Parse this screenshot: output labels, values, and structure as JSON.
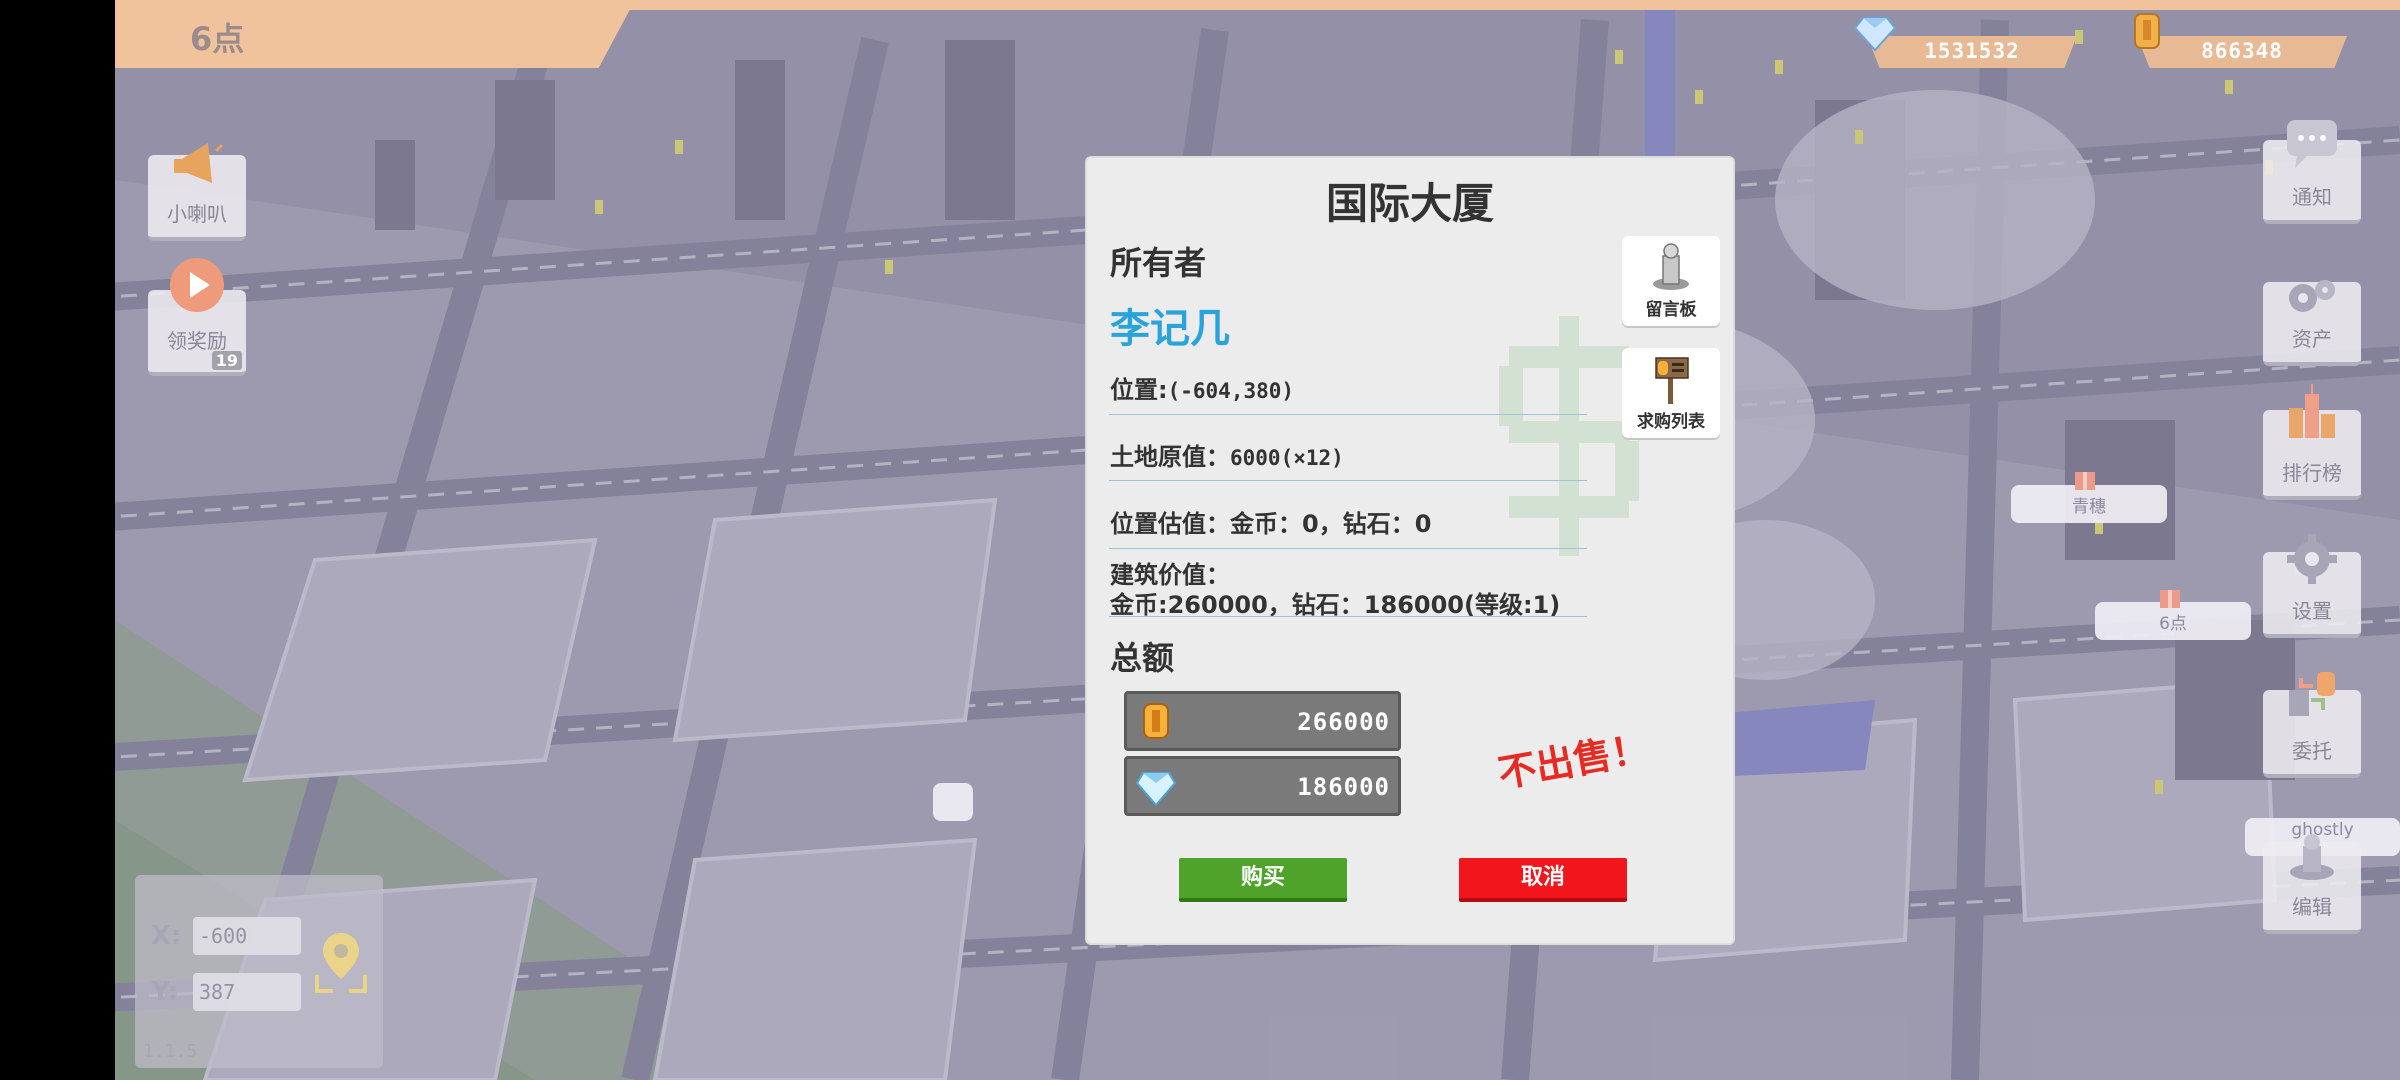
{
  "topbar": {
    "time_label": "6点"
  },
  "currency": {
    "diamonds": "1531532",
    "coins": "866348"
  },
  "left_buttons": {
    "speaker": "小喇叭",
    "reward": "领奖励",
    "reward_badge": "19"
  },
  "coords": {
    "x_label": "X:",
    "x_value": "-600",
    "y_label": "Y:",
    "y_value": "387",
    "version": "1.1.5"
  },
  "right_buttons": {
    "notify": "通知",
    "assets": "资产",
    "rank": "排行榜",
    "settings": "设置",
    "commission": "委托",
    "edit": "编辑"
  },
  "bubbles": {
    "b1": "青穗",
    "b2": "6点",
    "b3": "ghostly"
  },
  "dialog": {
    "title": "国际大厦",
    "owner_label": "所有者",
    "owner_name": "李记几",
    "position_label": "位置:",
    "position_value": "(-604,380)",
    "land_label": "土地原值：",
    "land_value": "6000(×12)",
    "estimate_label": "位置估值：",
    "estimate_value": "金币：0，钻石：0",
    "building_label": "建筑价值：",
    "building_value": "金币:260000，钻石：186000(等级:1)",
    "total_label": "总额",
    "total_coins": "266000",
    "total_diamonds": "186000",
    "not_for_sale": "不出售！",
    "message_board": "留言板",
    "buy_list": "求购列表",
    "buy_button": "购买",
    "cancel_button": "取消"
  },
  "colors": {
    "owner_name": "#2aa3db",
    "buy": "#4fa32a",
    "cancel": "#f2151c",
    "not_for_sale": "#e82b22",
    "topbar": "#f1c39c"
  }
}
